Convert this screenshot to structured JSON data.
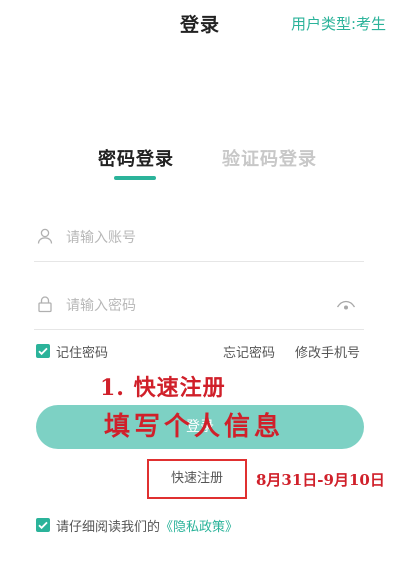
{
  "header": {
    "title": "登录",
    "user_type": "用户类型:考生"
  },
  "tabs": {
    "password": "密码登录",
    "code": "验证码登录"
  },
  "form": {
    "account_placeholder": "请输入账号",
    "password_placeholder": "请输入密码",
    "remember_label": "记住密码",
    "forgot_label": "忘记密码",
    "change_phone_label": "修改手机号",
    "login_label": "登录",
    "register_label": "快速注册",
    "privacy_prefix": "请仔细阅读我们的",
    "privacy_link": "《隐私政策》"
  },
  "annotation": {
    "line1": "1. 快速注册",
    "line2": "填写个人信息",
    "date_range": "8月31日-9月10日"
  },
  "colors": {
    "accent": "#2bb39a",
    "button": "#7dd1c4",
    "annotation": "#d0202a"
  },
  "icons": {
    "account": "person-icon",
    "password": "lock-icon",
    "visibility": "eye-icon",
    "checkbox": "check-icon"
  }
}
